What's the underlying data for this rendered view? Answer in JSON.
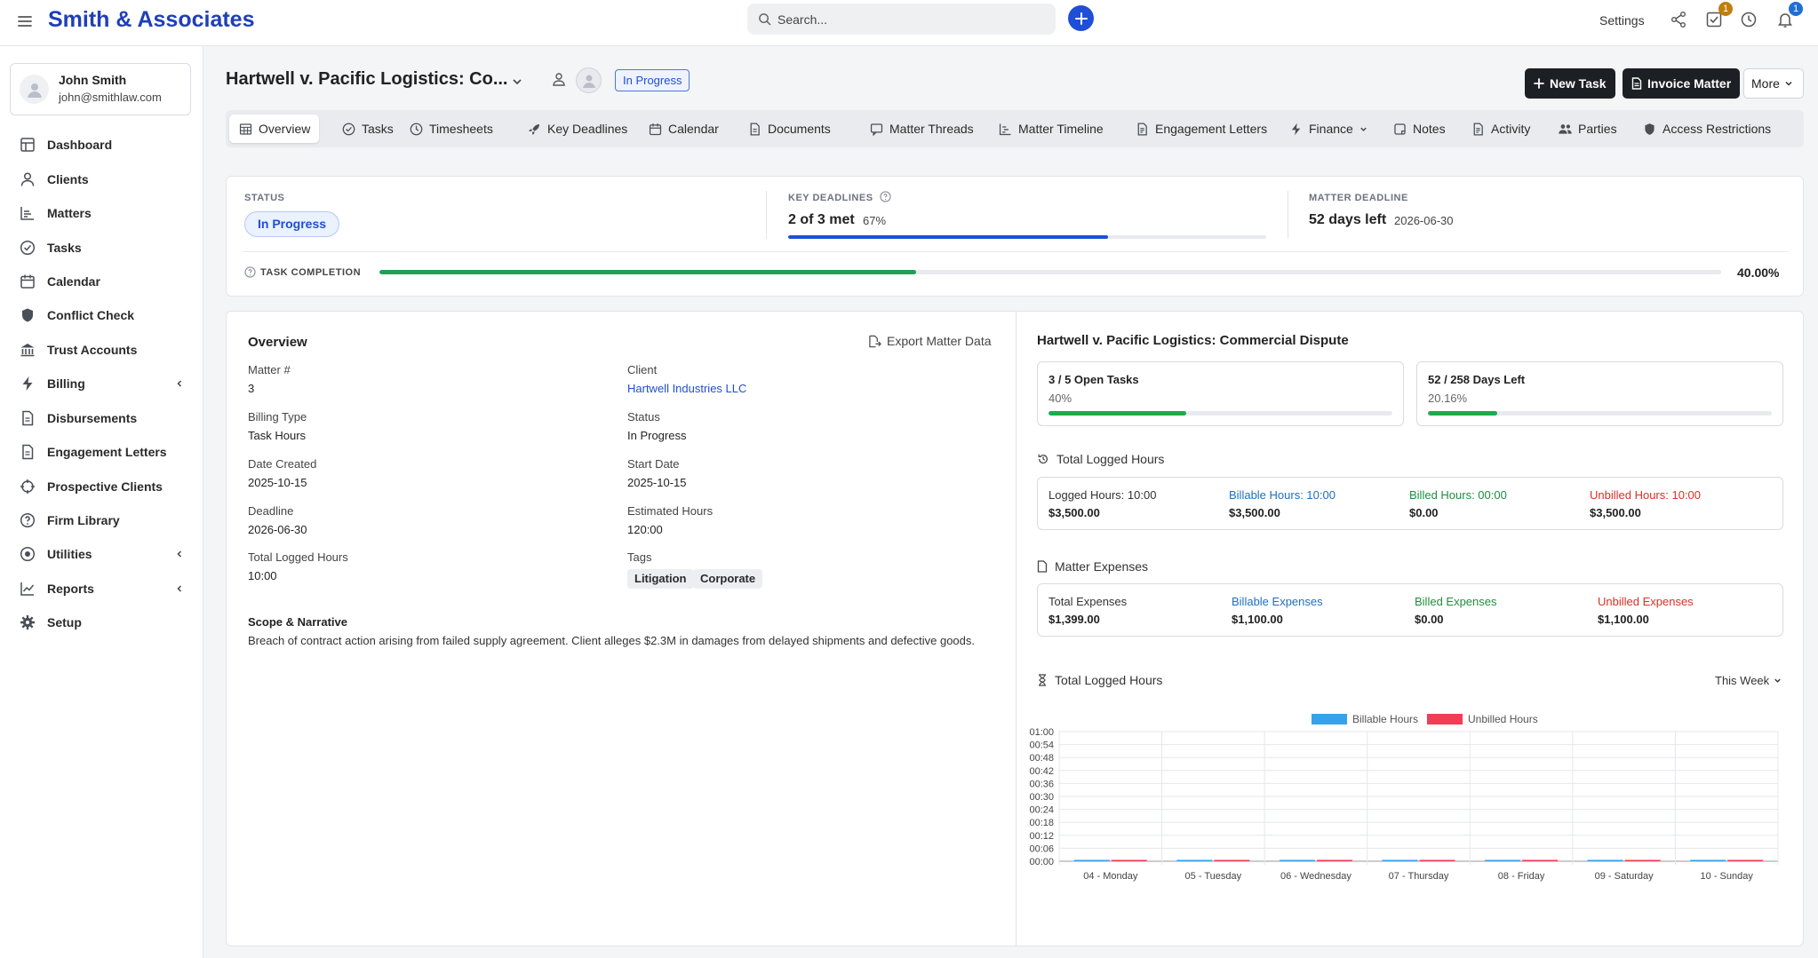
{
  "app": {
    "brand": "Smith & Associates"
  },
  "topbar": {
    "search_placeholder": "Search...",
    "settings_label": "Settings",
    "tasks_badge": "1",
    "notifications_badge": "1"
  },
  "user": {
    "name": "John Smith",
    "email": "john@smithlaw.com"
  },
  "sidebar": {
    "items": [
      {
        "label": "Dashboard",
        "icon": "grid-icon"
      },
      {
        "label": "Clients",
        "icon": "user-icon"
      },
      {
        "label": "Matters",
        "icon": "chart-icon"
      },
      {
        "label": "Tasks",
        "icon": "check-circle-icon"
      },
      {
        "label": "Calendar",
        "icon": "calendar-icon"
      },
      {
        "label": "Conflict Check",
        "icon": "shield-icon"
      },
      {
        "label": "Trust Accounts",
        "icon": "bank-icon"
      },
      {
        "label": "Billing",
        "icon": "bolt-icon",
        "expandable": true
      },
      {
        "label": "Disbursements",
        "icon": "document-icon"
      },
      {
        "label": "Engagement Letters",
        "icon": "document-icon"
      },
      {
        "label": "Prospective Clients",
        "icon": "crosshair-icon"
      },
      {
        "label": "Firm Library",
        "icon": "help-circle-icon"
      },
      {
        "label": "Utilities",
        "icon": "target-icon",
        "expandable": true
      },
      {
        "label": "Reports",
        "icon": "line-chart-icon",
        "expandable": true
      },
      {
        "label": "Setup",
        "icon": "gear-icon"
      }
    ]
  },
  "header": {
    "title": "Hartwell v. Pacific Logistics: Co...",
    "status": "In Progress",
    "new_task": "New Task",
    "invoice_matter": "Invoice Matter",
    "more": "More"
  },
  "tabs": [
    {
      "label": "Overview",
      "icon": "table-icon",
      "active": true
    },
    {
      "label": "Tasks",
      "icon": "check-circle-icon"
    },
    {
      "label": "Timesheets",
      "icon": "clock-icon"
    },
    {
      "label": "Key Deadlines",
      "icon": "rocket-icon"
    },
    {
      "label": "Calendar",
      "icon": "calendar-icon"
    },
    {
      "label": "Documents",
      "icon": "document-icon"
    },
    {
      "label": "Matter Threads",
      "icon": "chat-icon"
    },
    {
      "label": "Matter Timeline",
      "icon": "timeline-icon"
    },
    {
      "label": "Engagement Letters",
      "icon": "file-text-icon"
    },
    {
      "label": "Finance",
      "icon": "bolt-icon",
      "dropdown": true
    },
    {
      "label": "Notes",
      "icon": "note-icon"
    },
    {
      "label": "Activity",
      "icon": "file-text-icon"
    },
    {
      "label": "Parties",
      "icon": "users-icon"
    },
    {
      "label": "Access Restrictions",
      "icon": "shield-icon"
    }
  ],
  "summary": {
    "status_label": "STATUS",
    "status_value": "In Progress",
    "key_deadlines_label": "KEY DEADLINES",
    "key_deadlines_value": "2 of 3 met",
    "key_deadlines_pct": "67%",
    "key_deadlines_progress": 0.67,
    "matter_deadline_label": "MATTER DEADLINE",
    "matter_deadline_value": "52 days left",
    "matter_deadline_date": "2026-06-30",
    "task_completion_label": "TASK COMPLETION",
    "task_completion_value": "40.00%",
    "task_completion_progress": 0.4
  },
  "overview": {
    "title": "Overview",
    "export_label": "Export Matter Data",
    "fields_left": [
      {
        "label": "Matter #",
        "value": "3"
      },
      {
        "label": "Billing Type",
        "value": "Task Hours"
      },
      {
        "label": "Date Created",
        "value": "2025-10-15"
      },
      {
        "label": "Deadline",
        "value": "2026-06-30"
      },
      {
        "label": "Total Logged Hours",
        "value": "10:00"
      }
    ],
    "fields_right": [
      {
        "label": "Client",
        "value": "Hartwell Industries LLC"
      },
      {
        "label": "Status",
        "value": "In Progress"
      },
      {
        "label": "Start Date",
        "value": "2025-10-15"
      },
      {
        "label": "Estimated Hours",
        "value": "120:00"
      },
      {
        "label": "Tags",
        "value": ""
      }
    ],
    "tags": [
      "Litigation",
      "Corporate"
    ],
    "scope_label": "Scope & Narrative",
    "scope_text": "Breach of contract action arising from failed supply agreement. Client alleges $2.3M in damages from delayed shipments and defective goods."
  },
  "right_panel": {
    "title": "Hartwell v. Pacific Logistics: Commercial Dispute",
    "open_tasks": {
      "label": "3 / 5 Open Tasks",
      "pct": "40%",
      "progress": 0.4
    },
    "days_left": {
      "label": "52 / 258 Days Left",
      "pct": "20.16%",
      "progress": 0.2016
    },
    "logged_hours_title": "Total Logged Hours",
    "logged_hours": [
      {
        "label": "Logged Hours: 10:00",
        "value": "$3,500.00",
        "color": "#333333"
      },
      {
        "label": "Billable Hours: 10:00",
        "value": "$3,500.00",
        "color": "#1f6fbf"
      },
      {
        "label": "Billed Hours: 00:00",
        "value": "$0.00",
        "color": "#1e8e3e"
      },
      {
        "label": "Unbilled Hours: 10:00",
        "value": "$3,500.00",
        "color": "#d93025"
      }
    ],
    "expenses_title": "Matter Expenses",
    "expenses": [
      {
        "label": "Total Expenses",
        "value": "$1,399.00",
        "color": "#333333"
      },
      {
        "label": "Billable Expenses",
        "value": "$1,100.00",
        "color": "#1f6fbf"
      },
      {
        "label": "Billed Expenses",
        "value": "$0.00",
        "color": "#1e8e3e"
      },
      {
        "label": "Unbilled Expenses",
        "value": "$1,100.00",
        "color": "#d93025"
      }
    ],
    "chart_title": "Total Logged Hours",
    "period": "This Week"
  },
  "chart_data": {
    "type": "bar",
    "categories": [
      "04 - Monday",
      "05 - Tuesday",
      "06 - Wednesday",
      "07 - Thursday",
      "08 - Friday",
      "09 - Saturday",
      "10 - Sunday"
    ],
    "series": [
      {
        "name": "Billable Hours",
        "color": "#36a2eb",
        "values": [
          0,
          0,
          0,
          0,
          0,
          0,
          0
        ]
      },
      {
        "name": "Unbilled Hours",
        "color": "#f23d54",
        "values": [
          0,
          0,
          0,
          0,
          0,
          0,
          0
        ]
      }
    ],
    "y_ticks": [
      "00:00",
      "00:06",
      "00:12",
      "00:18",
      "00:24",
      "00:30",
      "00:36",
      "00:42",
      "00:48",
      "00:54",
      "01:00"
    ],
    "ylim": [
      0,
      60
    ],
    "legend": "top",
    "grid": true
  }
}
